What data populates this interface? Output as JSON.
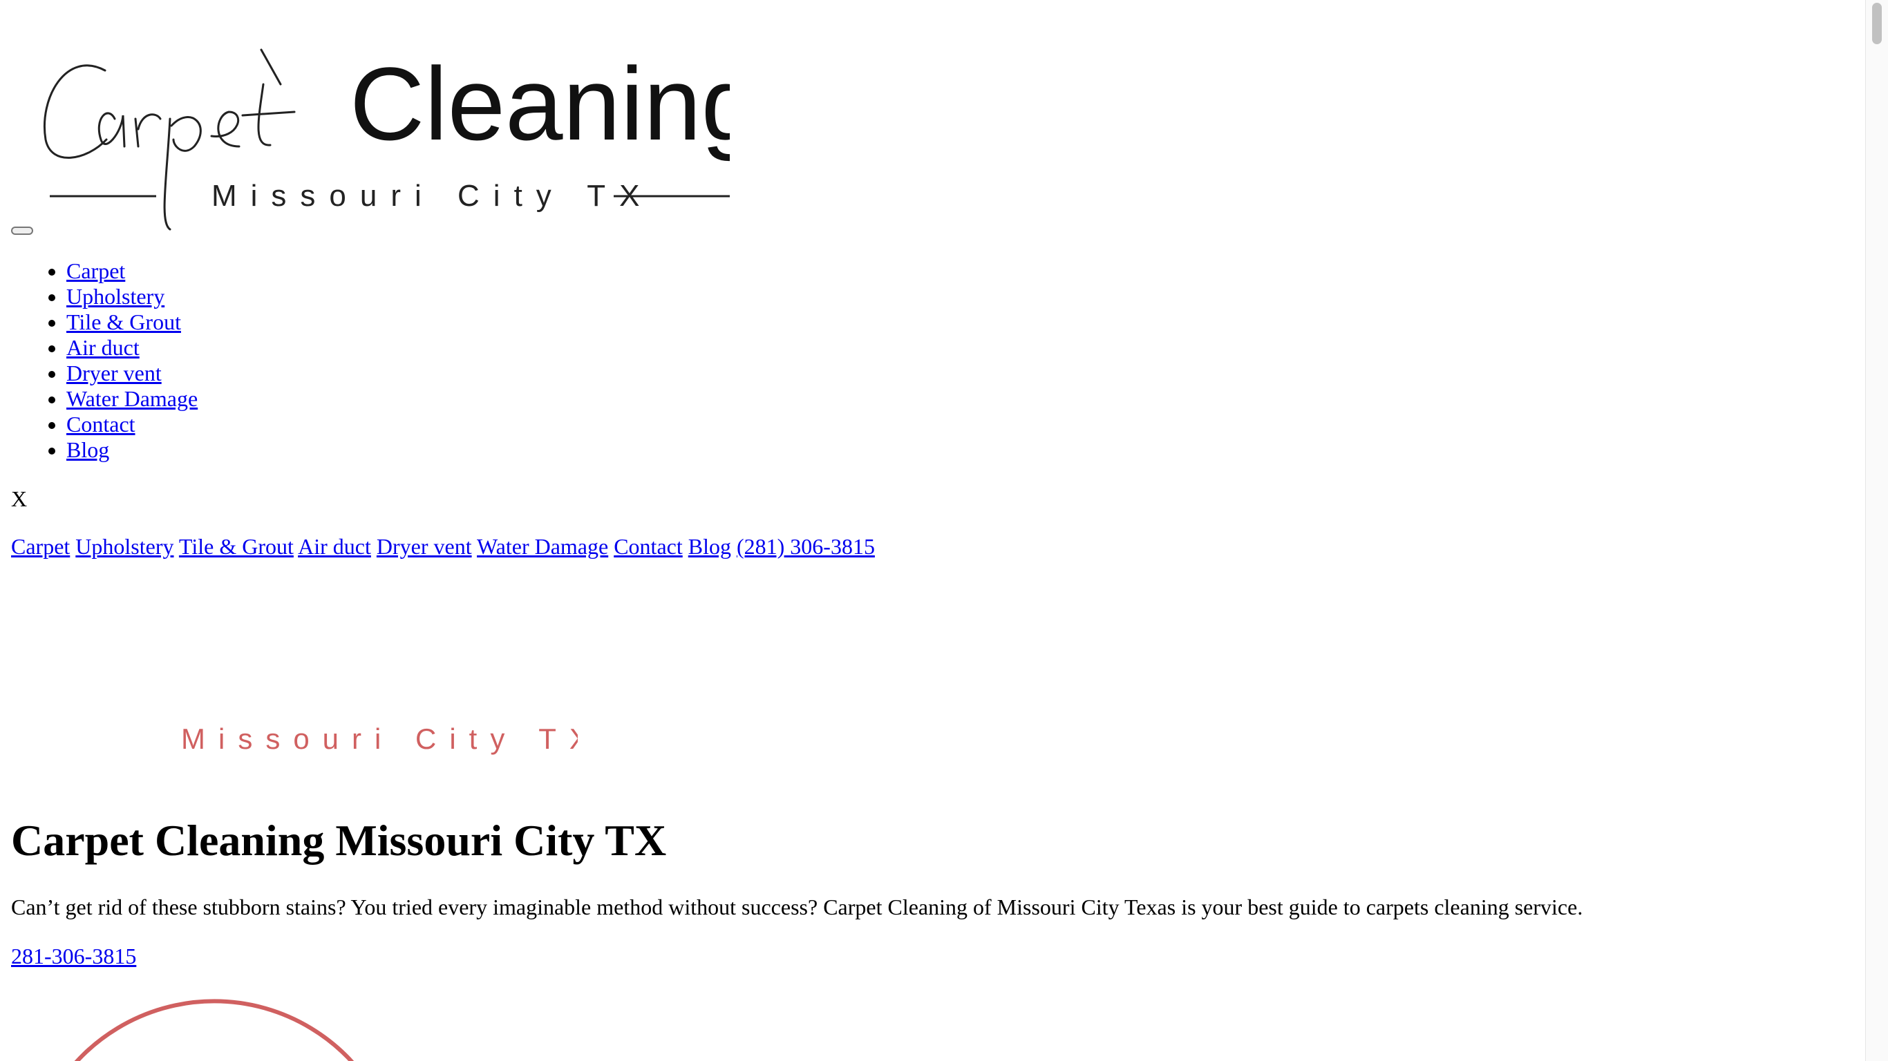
{
  "logo": {
    "script_word": "Carpet",
    "main_word": "Cleaning",
    "subtitle": "Missouri City TX"
  },
  "menu_toggle": {
    "label": ""
  },
  "mobile_menu": {
    "items": [
      "Carpet",
      "Upholstery",
      "Tile & Grout",
      "Air duct",
      "Dryer vent",
      "Water Damage",
      "Contact",
      "Blog"
    ]
  },
  "close_label": "X",
  "desktop_nav": {
    "items": [
      "Carpet",
      "Upholstery",
      "Tile & Grout",
      "Air duct",
      "Dryer vent",
      "Water Damage",
      "Contact",
      "Blog"
    ],
    "phone": "(281) 306-3815"
  },
  "banner": {
    "subtitle": "Missouri City TX"
  },
  "main": {
    "title": "Carpet Cleaning Missouri City TX",
    "intro": "Can’t get rid of these stubborn stains? You tried every imaginable method without success? Carpet Cleaning of Missouri City Texas is your best guide to carpets cleaning service.",
    "phone_cta": "281-306-3815"
  },
  "colors": {
    "link": "#0000ee",
    "banner_accent": "#d06060",
    "text": "#000000"
  }
}
